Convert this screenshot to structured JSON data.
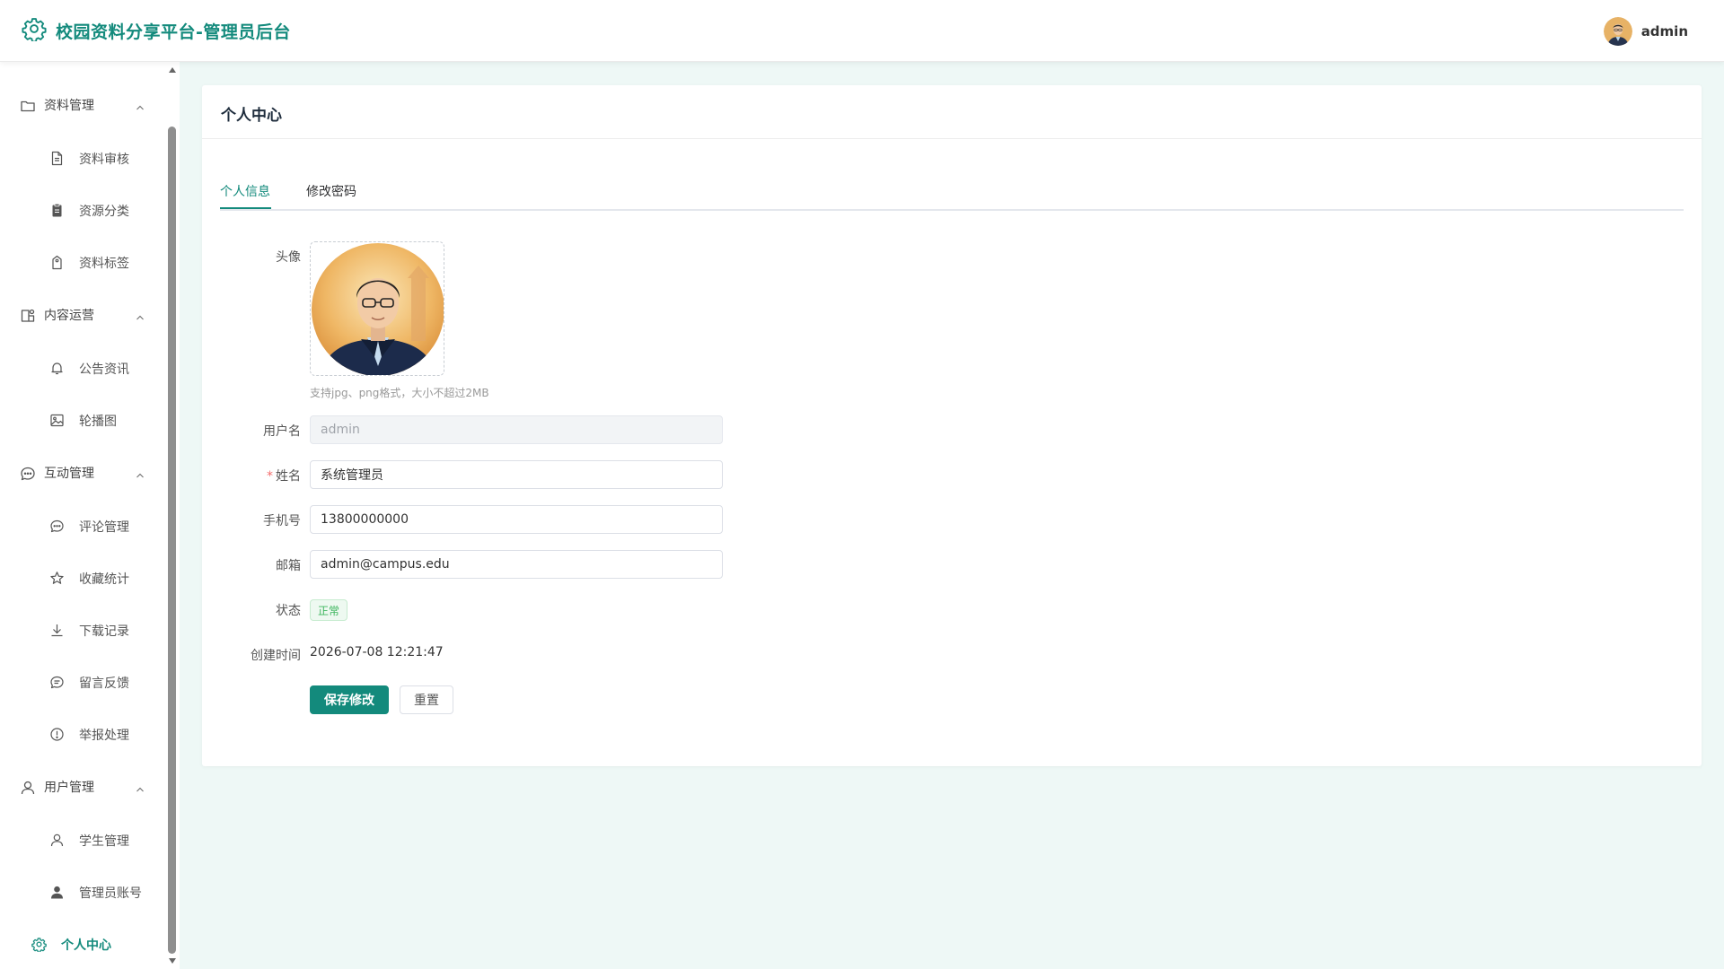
{
  "header": {
    "title": "校园资料分享平台-管理员后台",
    "username": "admin"
  },
  "sidebar": {
    "groups": [
      {
        "label": "资料管理",
        "items": [
          {
            "label": "资料审核"
          },
          {
            "label": "资源分类"
          },
          {
            "label": "资料标签"
          }
        ]
      },
      {
        "label": "内容运营",
        "items": [
          {
            "label": "公告资讯"
          },
          {
            "label": "轮播图"
          }
        ]
      },
      {
        "label": "互动管理",
        "items": [
          {
            "label": "评论管理"
          },
          {
            "label": "收藏统计"
          },
          {
            "label": "下载记录"
          },
          {
            "label": "留言反馈"
          },
          {
            "label": "举报处理"
          }
        ]
      },
      {
        "label": "用户管理",
        "items": [
          {
            "label": "学生管理"
          },
          {
            "label": "管理员账号"
          }
        ]
      }
    ],
    "active_item": "个人中心"
  },
  "page": {
    "title": "个人中心",
    "tabs": [
      {
        "label": "个人信息"
      },
      {
        "label": "修改密码"
      }
    ],
    "form": {
      "avatar_label": "头像",
      "avatar_hint": "支持jpg、png格式，大小不超过2MB",
      "username_label": "用户名",
      "username_value": "admin",
      "name_required_mark": "*",
      "name_label": "姓名",
      "name_value": "系统管理员",
      "phone_label": "手机号",
      "phone_value": "13800000000",
      "email_label": "邮箱",
      "email_value": "admin@campus.edu",
      "status_label": "状态",
      "status_value": "正常",
      "created_label": "创建时间",
      "created_value": "2026-07-08 12:21:47",
      "save_button": "保存修改",
      "reset_button": "重置"
    }
  },
  "colors": {
    "primary": "#138a7c",
    "main_bg": "#eef8f6",
    "status_green": "#3fb65f",
    "required_red": "#f56c6c"
  }
}
